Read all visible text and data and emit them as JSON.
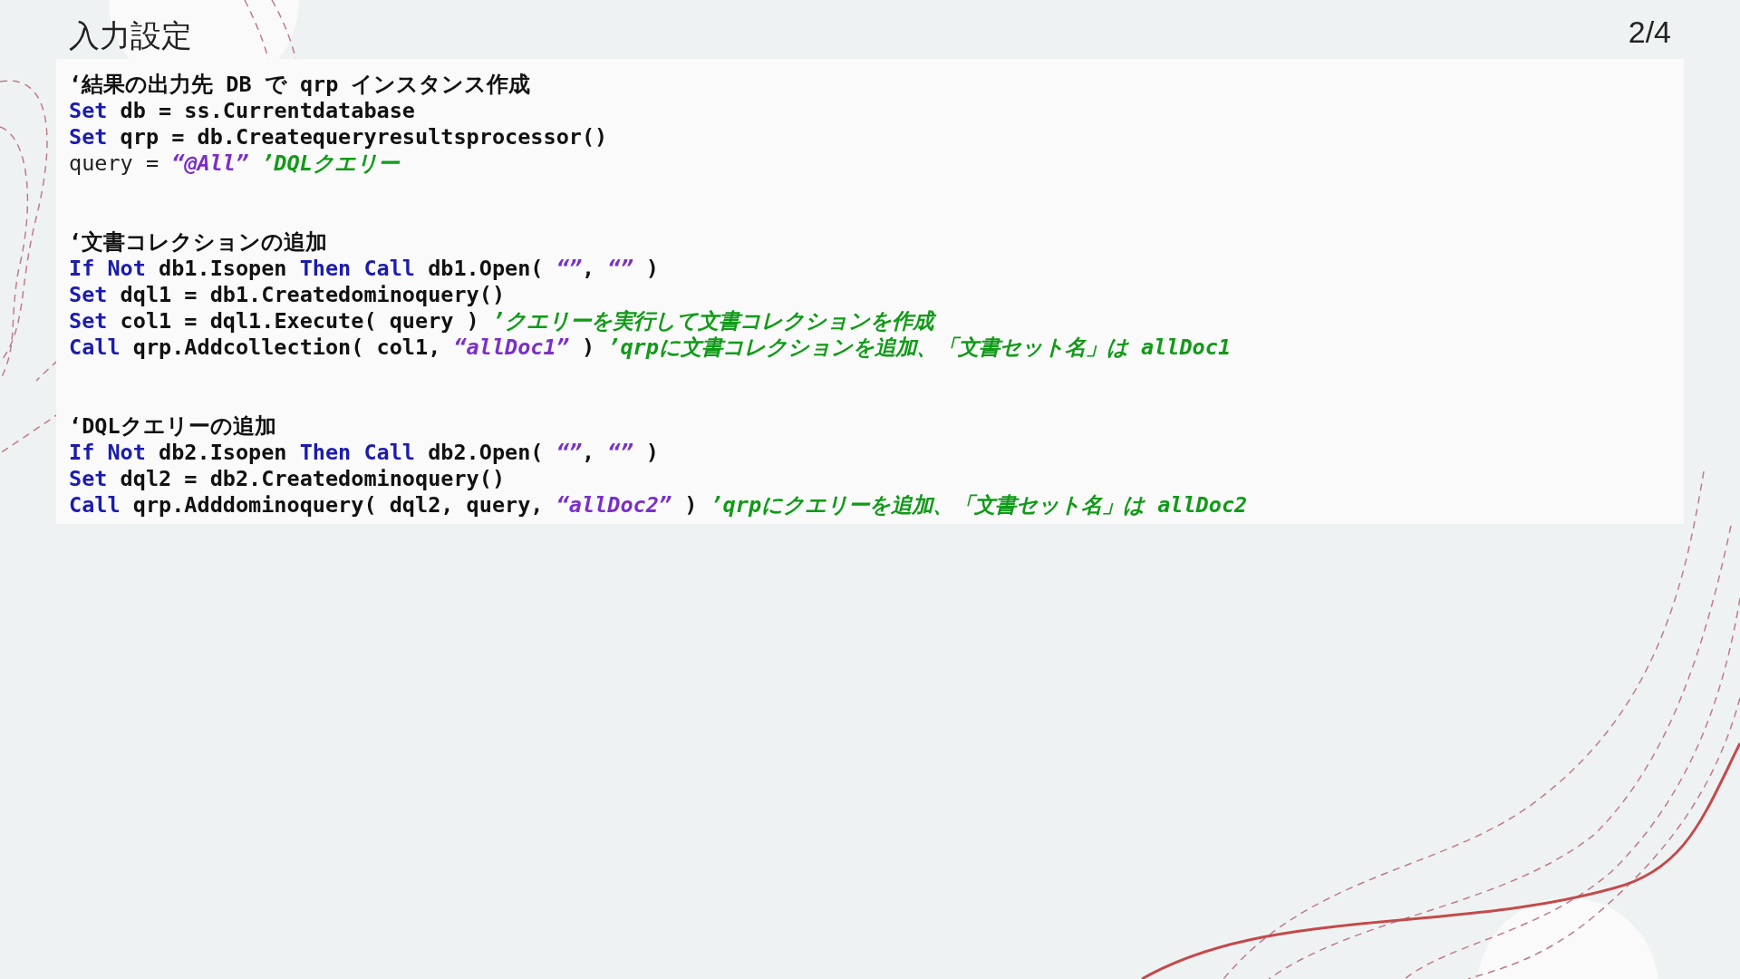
{
  "slide": {
    "title": "入力設定",
    "page_number": "2/4"
  },
  "code_blocks": [
    {
      "lines": [
        {
          "tokens": [
            {
              "kind": "plain",
              "text": "‘結果の出力先 DB で qrp インスタンス作成"
            }
          ]
        },
        {
          "tokens": [
            {
              "kind": "keyword",
              "text": "Set"
            },
            {
              "kind": "plain",
              "text": " db = ss.Currentdatabase"
            }
          ]
        },
        {
          "tokens": [
            {
              "kind": "keyword",
              "text": "Set"
            },
            {
              "kind": "plain",
              "text": " qrp = db.Createqueryresultsprocessor()"
            }
          ]
        },
        {
          "tokens": [
            {
              "kind": "light",
              "text": "query = "
            },
            {
              "kind": "string",
              "text": "“@All”"
            },
            {
              "kind": "comment",
              "text": " ’DQLクエリー"
            }
          ]
        }
      ]
    },
    {
      "lines": [
        {
          "tokens": [
            {
              "kind": "plain",
              "text": "‘文書コレクションの追加"
            }
          ]
        },
        {
          "tokens": [
            {
              "kind": "keyword",
              "text": "If Not"
            },
            {
              "kind": "plain",
              "text": " db1.Isopen "
            },
            {
              "kind": "keyword",
              "text": "Then Call"
            },
            {
              "kind": "plain",
              "text": " db1.Open( "
            },
            {
              "kind": "string",
              "text": "“”"
            },
            {
              "kind": "plain",
              "text": ", "
            },
            {
              "kind": "string",
              "text": "“”"
            },
            {
              "kind": "plain",
              "text": " )"
            }
          ]
        },
        {
          "tokens": [
            {
              "kind": "keyword",
              "text": "Set"
            },
            {
              "kind": "plain",
              "text": " dql1 = db1.Createdominoquery()"
            }
          ]
        },
        {
          "tokens": [
            {
              "kind": "keyword",
              "text": "Set"
            },
            {
              "kind": "plain",
              "text": " col1 = dql1.Execute( query ) "
            },
            {
              "kind": "comment",
              "text": "’クエリーを実行して文書コレクションを作成"
            }
          ]
        },
        {
          "tokens": [
            {
              "kind": "keyword",
              "text": "Call"
            },
            {
              "kind": "plain",
              "text": " qrp.Addcollection( col1, "
            },
            {
              "kind": "string",
              "text": "“allDoc1”"
            },
            {
              "kind": "plain",
              "text": " ) "
            },
            {
              "kind": "comment",
              "text": "’qrpに文書コレクションを追加、「文書セット名」は allDoc1"
            }
          ]
        }
      ]
    },
    {
      "lines": [
        {
          "tokens": [
            {
              "kind": "plain",
              "text": "‘DQLクエリーの追加"
            }
          ]
        },
        {
          "tokens": [
            {
              "kind": "keyword",
              "text": "If Not"
            },
            {
              "kind": "plain",
              "text": " db2.Isopen "
            },
            {
              "kind": "keyword",
              "text": "Then Call"
            },
            {
              "kind": "plain",
              "text": " db2.Open( "
            },
            {
              "kind": "string",
              "text": "“”"
            },
            {
              "kind": "plain",
              "text": ", "
            },
            {
              "kind": "string",
              "text": "“”"
            },
            {
              "kind": "plain",
              "text": " )"
            }
          ]
        },
        {
          "tokens": [
            {
              "kind": "keyword",
              "text": "Set"
            },
            {
              "kind": "plain",
              "text": " dql2 = db2.Createdominoquery()"
            }
          ]
        },
        {
          "tokens": [
            {
              "kind": "keyword",
              "text": "Call"
            },
            {
              "kind": "plain",
              "text": " qrp.Adddominoquery( dql2, query, "
            },
            {
              "kind": "string",
              "text": "“allDoc2”"
            },
            {
              "kind": "plain",
              "text": " ) "
            },
            {
              "kind": "comment",
              "text": "’qrpにクエリーを追加、「文書セット名」は allDoc2"
            }
          ]
        }
      ]
    }
  ]
}
